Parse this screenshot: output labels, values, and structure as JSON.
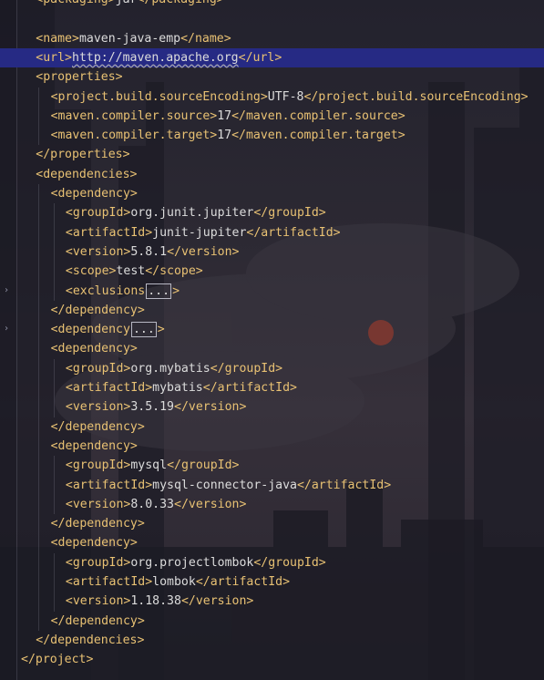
{
  "theme": {
    "tag_color": "#e8c173",
    "text_color": "#dcdcdc",
    "current_line_bg": "#262a84",
    "background": "#242330"
  },
  "fold_markers": [
    {
      "icon": "chevron-right-icon",
      "glyph": "›",
      "line": 15
    },
    {
      "icon": "chevron-right-icon",
      "glyph": "›",
      "line": 17
    }
  ],
  "editor": {
    "lines": [
      {
        "indent": 1,
        "segments": [
          [
            "tag",
            "<packaging>"
          ],
          [
            "text",
            "jar"
          ],
          [
            "tag",
            "</packaging>"
          ]
        ]
      },
      {
        "indent": 0,
        "segments": []
      },
      {
        "indent": 1,
        "segments": [
          [
            "tag",
            "<name>"
          ],
          [
            "text",
            "maven-java-emp"
          ],
          [
            "tag",
            "</name>"
          ]
        ]
      },
      {
        "indent": 1,
        "current": true,
        "segments": [
          [
            "tag",
            "<url>"
          ],
          [
            "url",
            "http://maven.apache.org"
          ],
          [
            "tag",
            "</url>"
          ]
        ]
      },
      {
        "indent": 1,
        "segments": [
          [
            "tag",
            "<properties>"
          ]
        ]
      },
      {
        "indent": 2,
        "segments": [
          [
            "tag",
            "<project.build.sourceEncoding>"
          ],
          [
            "text",
            "UTF-8"
          ],
          [
            "tag",
            "</project.build.sourceEncoding>"
          ]
        ]
      },
      {
        "indent": 2,
        "segments": [
          [
            "tag",
            "<maven.compiler.source>"
          ],
          [
            "text",
            "17"
          ],
          [
            "tag",
            "</maven.compiler.source>"
          ]
        ]
      },
      {
        "indent": 2,
        "segments": [
          [
            "tag",
            "<maven.compiler.target>"
          ],
          [
            "text",
            "17"
          ],
          [
            "tag",
            "</maven.compiler.target>"
          ]
        ]
      },
      {
        "indent": 1,
        "segments": [
          [
            "tag",
            "</properties>"
          ]
        ]
      },
      {
        "indent": 1,
        "segments": [
          [
            "tag",
            "<dependencies>"
          ]
        ]
      },
      {
        "indent": 2,
        "segments": [
          [
            "tag",
            "<dependency>"
          ]
        ]
      },
      {
        "indent": 3,
        "segments": [
          [
            "tag",
            "<groupId>"
          ],
          [
            "text",
            "org.junit.jupiter"
          ],
          [
            "tag",
            "</groupId>"
          ]
        ]
      },
      {
        "indent": 3,
        "segments": [
          [
            "tag",
            "<artifactId>"
          ],
          [
            "text",
            "junit-jupiter"
          ],
          [
            "tag",
            "</artifactId>"
          ]
        ]
      },
      {
        "indent": 3,
        "segments": [
          [
            "tag",
            "<version>"
          ],
          [
            "text",
            "5.8.1"
          ],
          [
            "tag",
            "</version>"
          ]
        ]
      },
      {
        "indent": 3,
        "segments": [
          [
            "tag",
            "<scope>"
          ],
          [
            "text",
            "test"
          ],
          [
            "tag",
            "</scope>"
          ]
        ]
      },
      {
        "indent": 3,
        "segments": [
          [
            "tag",
            "<exclusions"
          ],
          [
            "collapsed",
            "..."
          ],
          [
            "tag",
            ">"
          ]
        ]
      },
      {
        "indent": 2,
        "segments": [
          [
            "tag",
            "</dependency>"
          ]
        ]
      },
      {
        "indent": 2,
        "segments": [
          [
            "tag",
            "<dependency"
          ],
          [
            "collapsed",
            "..."
          ],
          [
            "tag",
            ">"
          ]
        ]
      },
      {
        "indent": 2,
        "segments": [
          [
            "tag",
            "<dependency>"
          ]
        ]
      },
      {
        "indent": 3,
        "segments": [
          [
            "tag",
            "<groupId>"
          ],
          [
            "text",
            "org.mybatis"
          ],
          [
            "tag",
            "</groupId>"
          ]
        ]
      },
      {
        "indent": 3,
        "segments": [
          [
            "tag",
            "<artifactId>"
          ],
          [
            "text",
            "mybatis"
          ],
          [
            "tag",
            "</artifactId>"
          ]
        ]
      },
      {
        "indent": 3,
        "segments": [
          [
            "tag",
            "<version>"
          ],
          [
            "text",
            "3.5.19"
          ],
          [
            "tag",
            "</version>"
          ]
        ]
      },
      {
        "indent": 2,
        "segments": [
          [
            "tag",
            "</dependency>"
          ]
        ]
      },
      {
        "indent": 2,
        "segments": [
          [
            "tag",
            "<dependency>"
          ]
        ]
      },
      {
        "indent": 3,
        "segments": [
          [
            "tag",
            "<groupId>"
          ],
          [
            "text",
            "mysql"
          ],
          [
            "tag",
            "</groupId>"
          ]
        ]
      },
      {
        "indent": 3,
        "segments": [
          [
            "tag",
            "<artifactId>"
          ],
          [
            "text",
            "mysql-connector-java"
          ],
          [
            "tag",
            "</artifactId>"
          ]
        ]
      },
      {
        "indent": 3,
        "segments": [
          [
            "tag",
            "<version>"
          ],
          [
            "text",
            "8.0.33"
          ],
          [
            "tag",
            "</version>"
          ]
        ]
      },
      {
        "indent": 2,
        "segments": [
          [
            "tag",
            "</dependency>"
          ]
        ]
      },
      {
        "indent": 2,
        "segments": [
          [
            "tag",
            "<dependency>"
          ]
        ]
      },
      {
        "indent": 3,
        "segments": [
          [
            "tag",
            "<groupId>"
          ],
          [
            "text",
            "org.projectlombok"
          ],
          [
            "tag",
            "</groupId>"
          ]
        ]
      },
      {
        "indent": 3,
        "segments": [
          [
            "tag",
            "<artifactId>"
          ],
          [
            "text",
            "lombok"
          ],
          [
            "tag",
            "</artifactId>"
          ]
        ]
      },
      {
        "indent": 3,
        "segments": [
          [
            "tag",
            "<version>"
          ],
          [
            "text",
            "1.18.38"
          ],
          [
            "tag",
            "</version>"
          ]
        ]
      },
      {
        "indent": 2,
        "segments": [
          [
            "tag",
            "</dependency>"
          ]
        ]
      },
      {
        "indent": 1,
        "segments": [
          [
            "tag",
            "</dependencies>"
          ]
        ]
      },
      {
        "indent": 0,
        "segments": [
          [
            "tag",
            "</project>"
          ]
        ]
      }
    ]
  }
}
